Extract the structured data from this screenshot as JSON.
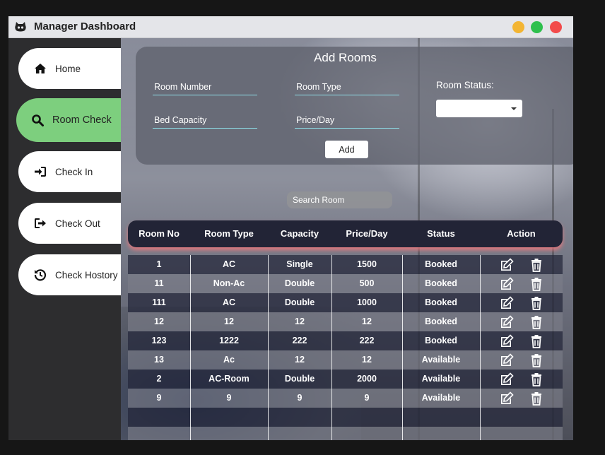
{
  "window": {
    "title": "Manager Dashboard",
    "app_icon": "github-cat-icon",
    "buttons": [
      "minimize",
      "maximize",
      "close"
    ],
    "colors": {
      "minimize": "#f3b533",
      "maximize": "#2ec04d",
      "close": "#f24b4b"
    }
  },
  "sidebar": {
    "items": [
      {
        "label": "Home",
        "icon": "home-icon",
        "active": false
      },
      {
        "label": "Room Check",
        "icon": "search-icon",
        "active": true
      },
      {
        "label": "Check In",
        "icon": "sign-in-icon",
        "active": false
      },
      {
        "label": "Check Out",
        "icon": "sign-out-icon",
        "active": false
      },
      {
        "label": "Check Hostory",
        "icon": "history-icon",
        "active": false
      }
    ],
    "active_color": "#7dcf7e"
  },
  "form": {
    "title": "Add Rooms",
    "room_number_placeholder": "Room Number",
    "room_type_placeholder": "Room Type",
    "bed_capacity_placeholder": "Bed Capacity",
    "price_placeholder": "Price/Day",
    "room_status_label": "Room Status:",
    "room_status_value": "",
    "add_label": "Add"
  },
  "search": {
    "placeholder": "Search Room"
  },
  "table": {
    "columns": [
      "Room No",
      "Room Type",
      "Capacity",
      "Price/Day",
      "Status",
      "Action"
    ],
    "rows": [
      [
        "1",
        "AC",
        "Single",
        "1500",
        "Booked"
      ],
      [
        "11",
        "Non-Ac",
        "Double",
        "500",
        "Booked"
      ],
      [
        "111",
        "AC",
        "Double",
        "1000",
        "Booked"
      ],
      [
        "12",
        "12",
        "12",
        "12",
        "Booked"
      ],
      [
        "123",
        "1222",
        "222",
        "222",
        "Booked"
      ],
      [
        "13",
        "Ac",
        "12",
        "12",
        "Available"
      ],
      [
        "2",
        "AC-Room",
        "Double",
        "2000",
        "Available"
      ],
      [
        "9",
        "9",
        "9",
        "9",
        "Available"
      ]
    ],
    "action_icons": [
      "edit-icon",
      "trash-icon"
    ],
    "header_glow_color": "#ef787d"
  }
}
